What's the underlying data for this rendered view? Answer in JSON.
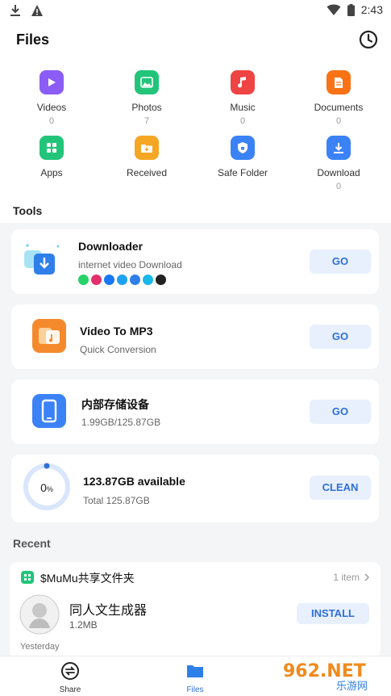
{
  "status_bar": {
    "time": "2:43"
  },
  "header": {
    "title": "Files"
  },
  "categories": [
    {
      "label": "Videos",
      "count": "0",
      "color": "#8b5cf6"
    },
    {
      "label": "Photos",
      "count": "7",
      "color": "#22c47a"
    },
    {
      "label": "Music",
      "count": "0",
      "color": "#ef4444"
    },
    {
      "label": "Documents",
      "count": "0",
      "color": "#f97316"
    },
    {
      "label": "Apps",
      "count": "",
      "color": "#22c47a"
    },
    {
      "label": "Received",
      "count": "",
      "color": "#f5a623"
    },
    {
      "label": "Safe Folder",
      "count": "",
      "color": "#3b82f6"
    },
    {
      "label": "Download",
      "count": "0",
      "color": "#3b82f6"
    }
  ],
  "tools": {
    "title": "Tools",
    "downloader": {
      "title": "Downloader",
      "subtitle": "internet video Download",
      "button": "GO"
    },
    "video_to_mp3": {
      "title": "Video To MP3",
      "subtitle": "Quick Conversion",
      "button": "GO"
    },
    "storage": {
      "title": "内部存储设备",
      "subtitle": "1.99GB/125.87GB",
      "button": "GO"
    },
    "cleaner": {
      "percent": "0",
      "percent_sign": "%",
      "title": "123.87GB available",
      "subtitle": "Total 125.87GB",
      "button": "CLEAN",
      "usage_fraction": 0.0
    }
  },
  "recent": {
    "title": "Recent",
    "folder_name": "$MuMu共享文件夹",
    "item_count": "1 item",
    "app_name": "同人文生成器",
    "app_size": "1.2MB",
    "install_label": "INSTALL",
    "date_label": "Yesterday"
  },
  "bottom_nav": {
    "share_label": "Share",
    "files_label": "Files"
  },
  "watermark": {
    "brand": "962.NET",
    "sub": "乐游网"
  },
  "colors": {
    "accent": "#2f6fd6",
    "button_bg": "#e8f0fd"
  }
}
